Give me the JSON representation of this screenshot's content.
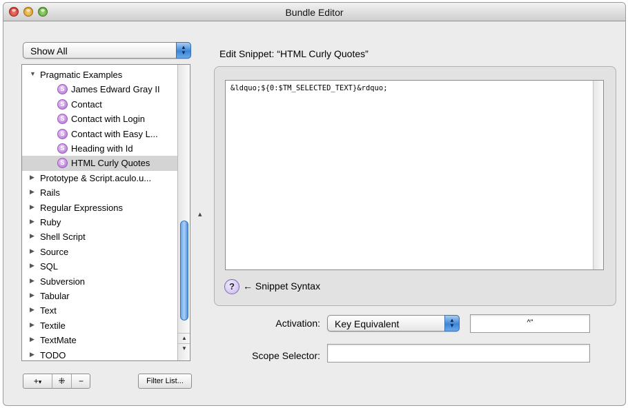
{
  "window": {
    "title": "Bundle Editor"
  },
  "sidebar": {
    "filter_popup": "Show All",
    "items": [
      {
        "label": "Pragmatic Examples",
        "expanded": true,
        "level": 0
      },
      {
        "label": "James Edward Gray II",
        "level": 1
      },
      {
        "label": "Contact",
        "level": 1
      },
      {
        "label": "Contact with Login",
        "level": 1
      },
      {
        "label": "Contact with Easy L...",
        "level": 1
      },
      {
        "label": "Heading with Id",
        "level": 1
      },
      {
        "label": "HTML Curly Quotes",
        "level": 1,
        "selected": true
      },
      {
        "label": "Prototype & Script.aculo.u...",
        "level": 0
      },
      {
        "label": "Rails",
        "level": 0
      },
      {
        "label": "Regular Expressions",
        "level": 0
      },
      {
        "label": "Ruby",
        "level": 0
      },
      {
        "label": "Shell Script",
        "level": 0
      },
      {
        "label": "Source",
        "level": 0
      },
      {
        "label": "SQL",
        "level": 0
      },
      {
        "label": "Subversion",
        "level": 0
      },
      {
        "label": "Tabular",
        "level": 0
      },
      {
        "label": "Text",
        "level": 0
      },
      {
        "label": "Textile",
        "level": 0
      },
      {
        "label": "TextMate",
        "level": 0
      },
      {
        "label": "TODO",
        "level": 0
      }
    ],
    "add_button": "+",
    "add_menu_arrow": "▾",
    "add_item_button": "⁜",
    "remove_button": "−",
    "filter_list_button": "Filter List..."
  },
  "main": {
    "heading": "Edit Snippet: “HTML Curly Quotes”",
    "snippet_text": "&ldquo;${0:$TM_SELECTED_TEXT}&rdquo;",
    "help_glyph": "?",
    "help_link": "Snippet Syntax",
    "activation_label": "Activation:",
    "activation_value": "Key Equivalent",
    "key_equivalent": "^\"",
    "scope_label": "Scope Selector:",
    "scope_value": ""
  },
  "colors": {
    "accent": "#3a86d8",
    "selection": "#d4d4d4",
    "snippet_icon": "#b06fd3"
  }
}
